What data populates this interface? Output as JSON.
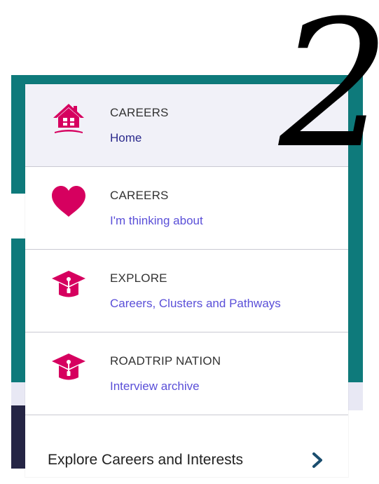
{
  "menu": {
    "items": [
      {
        "category": "CAREERS",
        "label": "Home",
        "icon": "house-icon"
      },
      {
        "category": "CAREERS",
        "label": "I'm thinking about",
        "icon": "heart-icon"
      },
      {
        "category": "EXPLORE",
        "label": "Careers, Clusters and Pathways",
        "icon": "graduation-cap-icon"
      },
      {
        "category": "ROADTRIP NATION",
        "label": "Interview archive",
        "icon": "graduation-cap-icon"
      }
    ]
  },
  "footer": {
    "label": "Explore Careers and Interests",
    "icon": "chevron-right-icon"
  },
  "overlay": {
    "numeral": "2"
  },
  "colors": {
    "accent_pink": "#d6005f",
    "link_purple": "#5a4fd8",
    "link_dark": "#2b2a8c",
    "teal": "#0e7a7b",
    "navy": "#252545"
  }
}
